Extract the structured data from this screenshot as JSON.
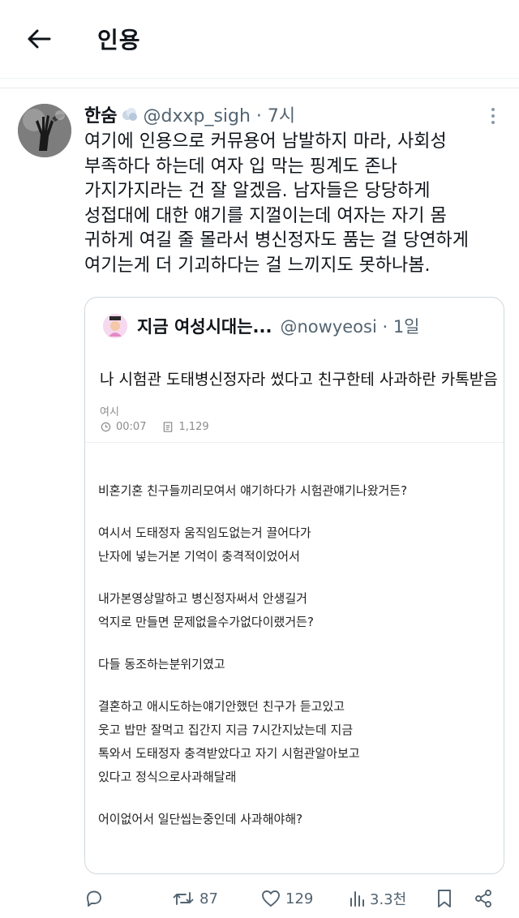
{
  "header": {
    "title": "인용",
    "back_icon": "arrow-left-icon"
  },
  "tweet": {
    "author_name": "한숨",
    "author_badge_icon": "cloud-emoji-icon",
    "handle_time": "@dxxp_sigh · 7시",
    "text_lines": [
      "여기에 인용으로 커뮤용어 남발하지 마라, 사회성",
      "부족하다 하는데 여자 입 막는 핑계도 존나",
      "가지가지라는 건 잘 알겠음. 남자들은 당당하게",
      "성접대에 대한 얘기를 지껄이는데 여자는 자기 몸",
      "귀하게 여길 줄 몰라서 병신정자도 품는 걸 당연하게",
      "여기는게 더 기괴하다는 걸 느끼지도 못하나봄."
    ]
  },
  "quote": {
    "author_name": "지금 여성시대는...",
    "handle_time": "@nowyeosi · 1일",
    "card": {
      "title": "나 시험관 도태병신정자라 썼다고 친구한테 사과하란 카톡받음",
      "author": "여시",
      "duration": "00:07",
      "views": "1,129",
      "paragraphs": [
        [
          "비혼기혼 친구들끼리모여서 얘기하다가 시험관얘기나왔거든?"
        ],
        [
          "여시서 도태정자 움직임도없는거 끌어다가",
          "난자에 넣는거본 기억이 충격적이었어서"
        ],
        [
          "내가본영상말하고 병신정자써서 안생길거",
          "억지로 만들면 문제없을수가없다이랬거든?"
        ],
        [
          "다들 동조하는분위기였고"
        ],
        [
          "결혼하고 애시도하는얘기안했던 친구가 듣고있고",
          "웃고 밥만 잘먹고 집간지 지금 7시간지났는데 지금",
          "톡와서 도태정자 충격받았다고 자기 시험관알아보고",
          "있다고 정식으로사과해달래"
        ],
        [
          "어이없어서 일단씹는중인데 사과해야해?"
        ]
      ]
    }
  },
  "actions": {
    "reply_icon": "reply-icon",
    "retweet_icon": "retweet-icon",
    "retweet_count": "87",
    "like_icon": "heart-icon",
    "like_count": "129",
    "views_icon": "bar-chart-icon",
    "views_count": "3.3천",
    "bookmark_icon": "bookmark-icon",
    "share_icon": "share-icon"
  }
}
